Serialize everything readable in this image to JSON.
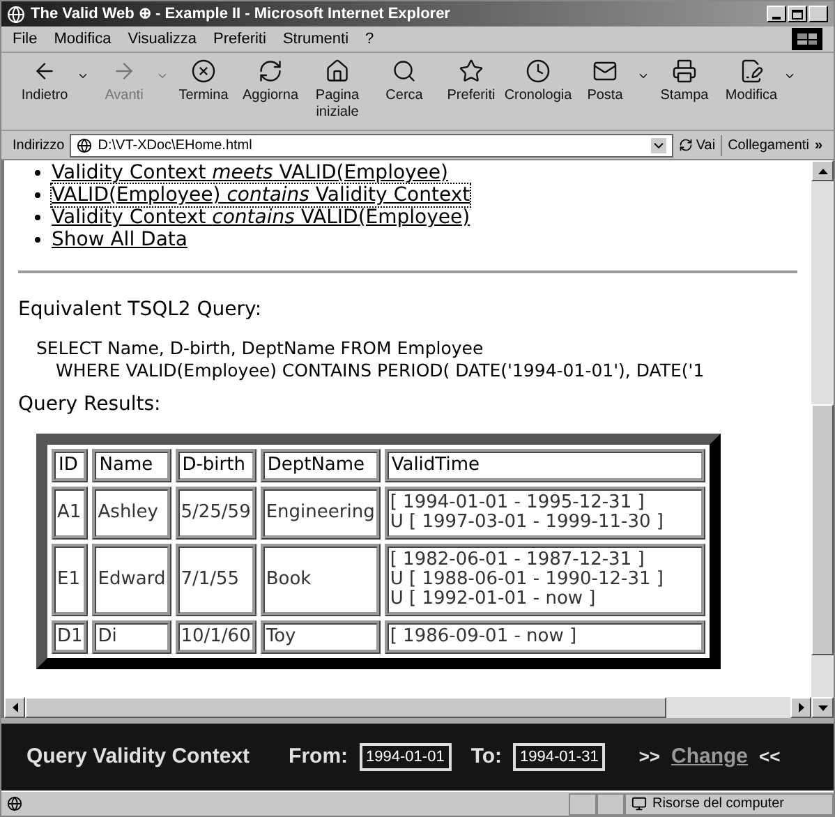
{
  "window": {
    "title": "The Valid Web ⊕ - Example II - Microsoft Internet Explorer"
  },
  "menu": [
    "File",
    "Modifica",
    "Visualizza",
    "Preferiti",
    "Strumenti",
    "?"
  ],
  "toolbar": [
    {
      "label": "Indietro",
      "disabled": false,
      "dropdown": true
    },
    {
      "label": "Avanti",
      "disabled": true,
      "dropdown": true
    },
    {
      "label": "Termina",
      "disabled": false,
      "dropdown": false
    },
    {
      "label": "Aggiorna",
      "disabled": false,
      "dropdown": false
    },
    {
      "label": "Pagina iniziale",
      "disabled": false,
      "dropdown": false
    },
    {
      "label": "Cerca",
      "disabled": false,
      "dropdown": false
    },
    {
      "label": "Preferiti",
      "disabled": false,
      "dropdown": false
    },
    {
      "label": "Cronologia",
      "disabled": false,
      "dropdown": false
    },
    {
      "label": "Posta",
      "disabled": false,
      "dropdown": true
    },
    {
      "label": "Stampa",
      "disabled": false,
      "dropdown": false
    },
    {
      "label": "Modifica",
      "disabled": false,
      "dropdown": true
    }
  ],
  "address": {
    "label": "Indirizzo",
    "value": "D:\\VT-XDoc\\EHome.html",
    "go": "Vai",
    "links": "Collegamenti",
    "more": "»"
  },
  "content": {
    "links": [
      {
        "text": "Validity Context *meets* VALID(Employee)",
        "focused": false
      },
      {
        "text": "VALID(Employee) *contains* Validity Context",
        "focused": true
      },
      {
        "text": "Validity Context *contains* VALID(Employee)",
        "focused": false
      },
      {
        "text": "Show All Data",
        "focused": false
      }
    ],
    "query_heading": "Equivalent TSQL2 Query:",
    "query_lines": [
      "SELECT Name, D-birth, DeptName FROM Employee",
      "WHERE VALID(Employee) CONTAINS PERIOD( DATE('1994-01-01'), DATE('1"
    ],
    "results_heading": "Query Results:",
    "table": {
      "columns": [
        "ID",
        "Name",
        "D-birth",
        "DeptName",
        "ValidTime"
      ],
      "rows": [
        {
          "cells": [
            "A1",
            "Ashley",
            "5/25/59",
            "Engineering"
          ],
          "valid_time": [
            "[ 1994-01-01 - 1995-12-31 ]",
            "U [ 1997-03-01 - 1999-11-30 ]"
          ]
        },
        {
          "cells": [
            "E1",
            "Edward",
            "7/1/55",
            "Book"
          ],
          "valid_time": [
            "[ 1982-06-01 - 1987-12-31 ]",
            "U [ 1988-06-01 - 1990-12-31 ]",
            "U [ 1992-01-01 - now ]"
          ]
        },
        {
          "cells": [
            "D1",
            "Di",
            "10/1/60",
            "Toy"
          ],
          "valid_time": [
            "[ 1986-09-01 - now ]"
          ]
        }
      ]
    }
  },
  "context_bar": {
    "title": "Query Validity Context",
    "from_label": "From:",
    "from_value": "1994-01-01",
    "to_label": "To:",
    "to_value": "1994-01-31",
    "prefix": ">>",
    "change": "Change",
    "suffix": "<<"
  },
  "status_bar": {
    "zone": "Risorse del computer"
  }
}
